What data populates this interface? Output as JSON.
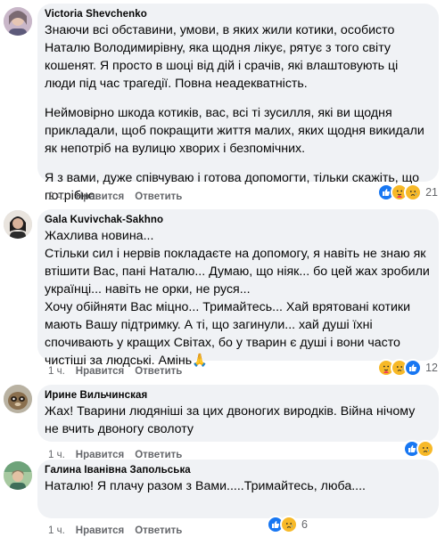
{
  "colors": {
    "bubble_bg": "#f0f2f5",
    "meta_text": "#65676b",
    "like_blue": "#1877f2",
    "emoji_yellow": "#f7b928"
  },
  "actions": {
    "like_label": "Нравится",
    "reply_label": "Ответить"
  },
  "comments": [
    {
      "author": "Victoria Shevchenko",
      "paragraphs": [
        "Знаючи всі обставини, умови, в яких жили котики, особисто Наталю Володимирівну, яка щодня лікує, рятує з того світу кошенят. Я просто в шоці від дій і срачів, які влаштовують ці люди під час трагедії. Повна неадекватність.",
        "Неймовірно шкода котиків, вас, всі ті зусилля, які ви щодня прикладали, щоб покращити життя малих, яких щодня викидали як непотріб на вулицю хворих і безпомічних.",
        "Я з вами, дуже співчуваю і готова допомогти, тільки скажіть, що потрібно."
      ],
      "time": "2 ч.",
      "reaction_icons": [
        "like-icon",
        "care-icon",
        "sad-icon"
      ],
      "reaction_count": "21"
    },
    {
      "author": "Gala Kuvivchak-Sakhno",
      "paragraphs": [
        "Жахлива новина...\nСтільки сил і нервів покладаєте на допомогу, я навіть не знаю як втішити Вас, пані Наталю... Думаю, що ніяк... бо цей жах зробили українці... навіть не орки, не руся...\nХочу обійняти Вас міцно... Тримайтесь... Хай врятовані котики мають Вашу підтримку. А ті, що загинули... хай душі їхні спочивають у кращих Світах, бо у тварин є душі і вони часто чистіші за людські. Амінь🙏"
      ],
      "time": "1 ч.",
      "reaction_icons": [
        "care-icon",
        "sad-icon",
        "like-icon"
      ],
      "reaction_count": "12"
    },
    {
      "author": "Ирине Вильчинская",
      "paragraphs": [
        "Жах! Тварини людяніші за цих двоногих виродків. Війна нічому не вчить двоногу сволоту"
      ],
      "time": "1 ч.",
      "reaction_icons": [
        "like-icon",
        "sad-icon"
      ],
      "reaction_count": ""
    },
    {
      "author": "Галина Іванівна Запольська",
      "paragraphs": [
        "Наталю! Я плачу разом з Вами.....Тримайтесь, люба...."
      ],
      "time": "1 ч.",
      "reaction_icons": [
        "like-icon",
        "sad-icon"
      ],
      "reaction_count": "6"
    }
  ]
}
